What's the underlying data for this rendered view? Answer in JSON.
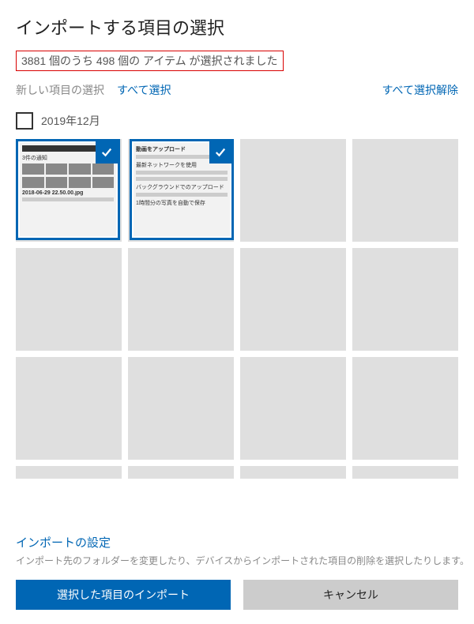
{
  "title": "インポートする項目の選択",
  "selectionCount": "3881 個のうち 498 個の アイテム が選択されました",
  "newSelectionLabel": "新しい項目の選択",
  "selectAll": "すべて選択",
  "deselectAll": "すべて選択解除",
  "group": {
    "label": "2019年12月",
    "checked": false
  },
  "thumbnails": [
    {
      "selected": true
    },
    {
      "selected": true
    }
  ],
  "settings": {
    "linkLabel": "インポートの設定",
    "description": "インポート先のフォルダーを変更したり、デバイスからインポートされた項目の削除を選択したりします。"
  },
  "buttons": {
    "import": "選択した項目のインポート",
    "cancel": "キャンセル"
  },
  "colors": {
    "accent": "#0066b4",
    "highlightBorder": "#d80000"
  }
}
